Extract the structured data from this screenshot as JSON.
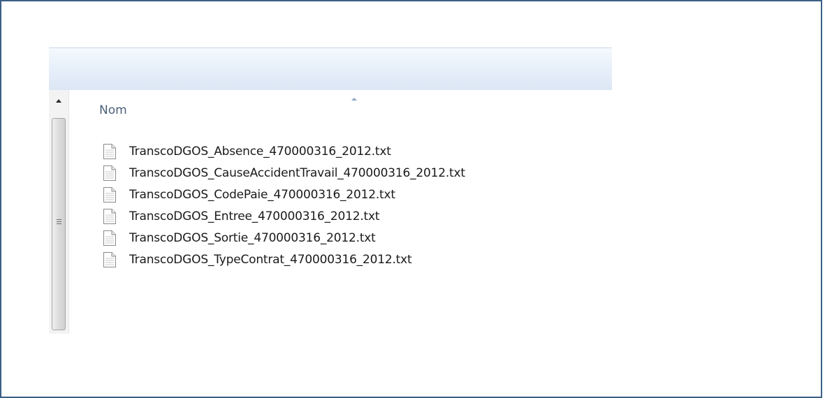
{
  "explorer": {
    "column_header": {
      "label": "Nom",
      "sort_icon": "sort-ascending-icon"
    },
    "scrollbar": {
      "up_icon": "scroll-up-arrow-icon",
      "grip_icon": "scroll-grip-icon"
    },
    "files": [
      {
        "name": "TranscoDGOS_Absence_470000316_2012.txt",
        "icon": "text-file-icon"
      },
      {
        "name": "TranscoDGOS_CauseAccidentTravail_470000316_2012.txt",
        "icon": "text-file-icon"
      },
      {
        "name": "TranscoDGOS_CodePaie_470000316_2012.txt",
        "icon": "text-file-icon"
      },
      {
        "name": "TranscoDGOS_Entree_470000316_2012.txt",
        "icon": "text-file-icon"
      },
      {
        "name": "TranscoDGOS_Sortie_470000316_2012.txt",
        "icon": "text-file-icon"
      },
      {
        "name": "TranscoDGOS_TypeContrat_470000316_2012.txt",
        "icon": "text-file-icon"
      }
    ]
  },
  "colors": {
    "frame_border": "#3a5f86",
    "toolbar_gradient_top": "#f5f9fd",
    "toolbar_gradient_bottom": "#dce7f5",
    "header_text": "#4c607a",
    "file_text": "#1a1a1a"
  }
}
